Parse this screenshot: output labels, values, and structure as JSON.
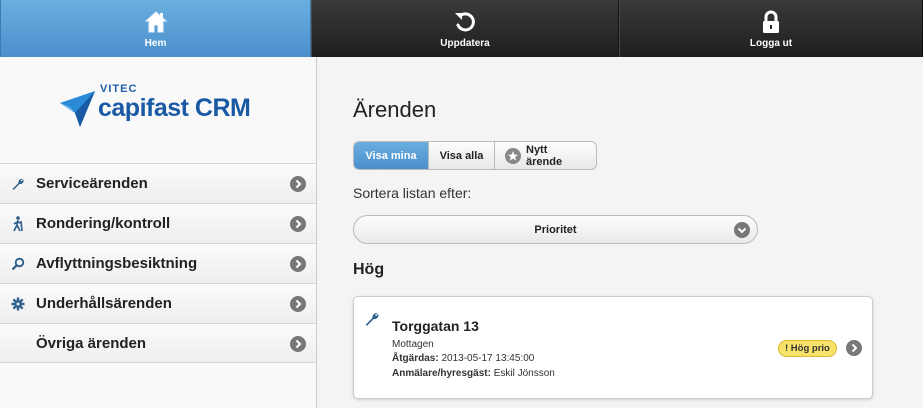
{
  "toolbar": {
    "home_label": "Hem",
    "refresh_label": "Uppdatera",
    "logout_label": "Logga ut"
  },
  "logo": {
    "company": "VITEC",
    "product": "capifast CRM"
  },
  "sidebar": {
    "items": [
      {
        "label": "Serviceärenden",
        "icon": "wrench-icon"
      },
      {
        "label": "Rondering/kontroll",
        "icon": "walking-person-icon"
      },
      {
        "label": "Avflyttningsbesiktning",
        "icon": "magnifier-icon"
      },
      {
        "label": "Underhållsärenden",
        "icon": "gear-icon"
      },
      {
        "label": "Övriga ärenden",
        "icon": ""
      }
    ]
  },
  "main": {
    "title": "Ärenden",
    "filters": {
      "show_mine": "Visa mina",
      "show_all": "Visa alla",
      "new_case": "Nytt ärende",
      "selected": "Visa mina"
    },
    "sort_label": "Sortera listan efter:",
    "sort_value": "Prioritet",
    "group_title": "Hög",
    "cases": [
      {
        "title": "Torggatan 13",
        "status": "Mottagen",
        "action_label": "Åtgärdas:",
        "action_value": "2013-05-17 13:45:00",
        "reporter_label": "Anmälare/hyresgäst:",
        "reporter_value": "Eskil Jönsson",
        "badge": "! Hög prio"
      }
    ]
  },
  "colors": {
    "accent": "#5a9fd6",
    "toolbar_dark": "#2a2a2a",
    "badge": "#f8e36a",
    "brand": "#1a5aa5"
  }
}
